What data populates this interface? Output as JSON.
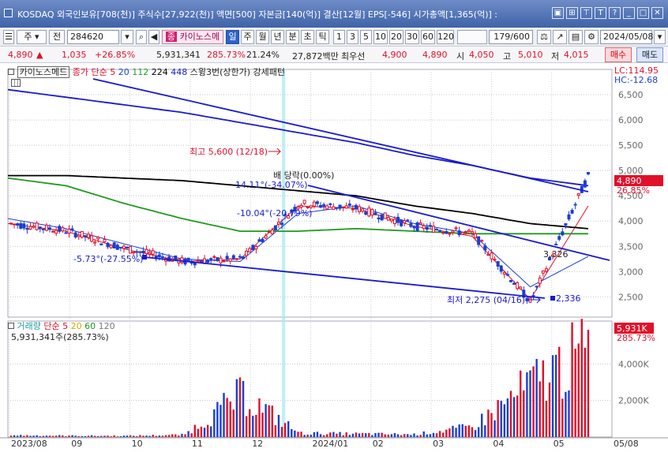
{
  "window": {
    "title": "KOSDAQ 외국인보유[708(천)] 주식수[27,922(천)] 액면[500] 자본금[140(억)] 결산[12월] EPS[-546] 시가총액[1,365(억)] :",
    "title_icons": [
      "window-icon",
      "grid-icon",
      "pin-icon",
      "text-icon",
      "help-icon",
      "minimize-icon",
      "maximize-icon",
      "close-icon"
    ],
    "title_icon_glyphs": [
      "▣",
      "⊞",
      "⊤",
      "T",
      "?",
      "_",
      "□",
      "✕"
    ]
  },
  "toolbar": {
    "market_select": "주",
    "jeon_label": "전",
    "code_value": "284620",
    "stock_name": "카이노스메",
    "stock_badge": "종",
    "periods": [
      "일",
      "주",
      "월",
      "년",
      "분",
      "초",
      "틱"
    ],
    "active_period": "일",
    "intervals": [
      "1",
      "3",
      "5",
      "10",
      "20",
      "30",
      "60",
      "120"
    ],
    "count_display": "179/600",
    "date_value": "2024/05/08"
  },
  "quote": {
    "price": "4,890",
    "change_arrow": "▲",
    "change": "1,035",
    "change_pct": "+26.85%",
    "volume": "5,931,341",
    "volume_ratio": "285.73%",
    "turnover": "21.24%",
    "amount": "27,872백만",
    "best_ask_label": "최우선",
    "best_ask": "4,900",
    "best_bid": "4,890",
    "open_label": "시",
    "open": "4,050",
    "high_label": "고",
    "high": "5,010",
    "low_label": "저",
    "low": "4,015",
    "buy_label": "매수",
    "sell_label": "매도"
  },
  "price_panel": {
    "legend": {
      "name": "카이노스메드",
      "ma_label": "종가 단순",
      "ma_periods": [
        "5",
        "20",
        "112",
        "224",
        "448"
      ],
      "ma_colors": [
        "#e0102a",
        "#1a3fd0",
        "#1f9b1f",
        "#000000",
        "#1a1ad0"
      ],
      "pattern": "스윙3번(상한가) 강세패턴"
    },
    "lc_label": "LC:114.95",
    "hc_label": "HC:-12.68",
    "current_tag": "4,890",
    "current_pct": "26.85%",
    "annotations": {
      "high": "최고 5,600 (12/18)",
      "low": "최저 2,275 (04/16)",
      "ex_rights": "배 당락(0.00%)",
      "angle1": "14.11°(-34.07%)",
      "angle2": "-10.04°(-20.79%)",
      "angle3": "-5.73°(-27.55%)",
      "mark_3326": "3,326",
      "mark_2336": "2,336"
    }
  },
  "volume_panel": {
    "legend": {
      "name": "거래량",
      "ma_label": "단순",
      "ma_periods": [
        "5",
        "20",
        "60",
        "120"
      ],
      "ma_colors": [
        "#e0102a",
        "#c9b000",
        "#1f9b1f",
        "#777777"
      ]
    },
    "value_text": "5,931,341주(285.73%)",
    "current_tag": "5,931K",
    "current_pct": "285.73%"
  },
  "x_axis_labels": [
    "2023/08",
    "09",
    "10",
    "11",
    "12",
    "2024/01",
    "02",
    "03",
    "04",
    "05",
    "05/08"
  ],
  "chart_data": [
    {
      "type": "candlestick",
      "title": "카이노스메드",
      "x": [
        "2023/08",
        "09",
        "10",
        "11",
        "12",
        "2024/01",
        "02",
        "03",
        "04",
        "05",
        "05/08"
      ],
      "close": [
        3950,
        3800,
        3450,
        3200,
        3250,
        4350,
        4250,
        3900,
        3750,
        2400,
        4890
      ],
      "ylim": [
        2100,
        7000
      ],
      "y_ticks": [
        2500,
        3000,
        3500,
        4000,
        4500,
        5000,
        5500,
        6000,
        6500
      ],
      "y_tick_labels": [
        "2,500",
        "3,000",
        "3,500",
        "4,000",
        "4,500",
        "5,000",
        "5,500",
        "6,000",
        "6,500"
      ],
      "series": [
        {
          "name": "5",
          "values": [
            3950,
            3800,
            3450,
            3200,
            3250,
            4300,
            4250,
            3900,
            3700,
            2450,
            4300
          ]
        },
        {
          "name": "20",
          "values": [
            4050,
            3850,
            3550,
            3250,
            3200,
            4150,
            4300,
            3950,
            3750,
            2700,
            3300
          ]
        },
        {
          "name": "112",
          "values": [
            4850,
            4700,
            4350,
            4050,
            3800,
            3800,
            3850,
            3800,
            3750,
            3750,
            3750
          ]
        },
        {
          "name": "224",
          "values": [
            4900,
            4900,
            4850,
            4800,
            4700,
            4600,
            4500,
            4300,
            4150,
            3950,
            3850
          ]
        },
        {
          "name": "448",
          "values": [
            6600,
            6450,
            6300,
            6150,
            5950,
            5750,
            5550,
            5300,
            5100,
            4850,
            4700
          ]
        }
      ],
      "grid": true,
      "legend": "top-left"
    },
    {
      "type": "bar",
      "title": "거래량",
      "categories": [
        "2023/08",
        "09",
        "10",
        "11",
        "12",
        "2024/01",
        "02",
        "03",
        "04",
        "05",
        "05/08"
      ],
      "values": [
        120,
        90,
        80,
        150,
        2900,
        260,
        220,
        180,
        700,
        3600,
        5931
      ],
      "ylim": [
        0,
        6000
      ],
      "y_ticks": [
        2000,
        4000
      ],
      "y_tick_labels": [
        "2,000K",
        "4,000K"
      ],
      "grid": true
    }
  ]
}
